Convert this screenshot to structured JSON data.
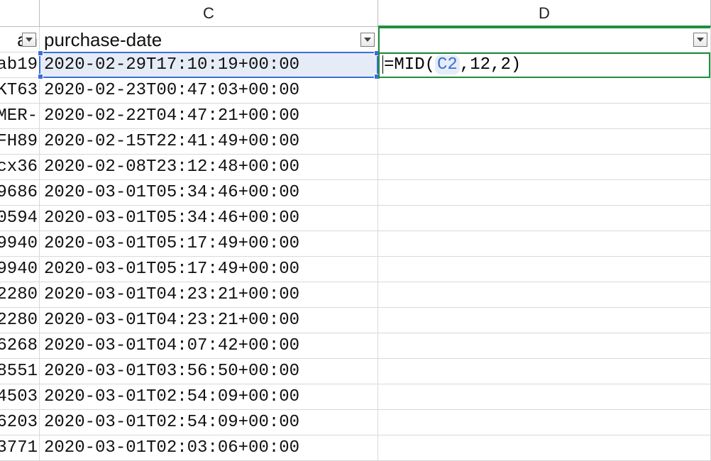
{
  "columns": {
    "b_letter": "",
    "c_letter": "C",
    "d_letter": "D"
  },
  "header_row": {
    "b": "an",
    "c": "purchase-date",
    "d": ""
  },
  "formula": {
    "prefix": "=MID(",
    "ref": "C2",
    "sep1": ",",
    "arg2": "12",
    "sep2": ",",
    "arg3": "2",
    "suffix": ")"
  },
  "rows": [
    {
      "b": "ab19",
      "c": "2020-02-29T17:10:19+00:00",
      "d": ""
    },
    {
      "b": "KT63",
      "c": "2020-02-23T00:47:03+00:00",
      "d": ""
    },
    {
      "b": "MER-",
      "c": "2020-02-22T04:47:21+00:00",
      "d": ""
    },
    {
      "b": "FH89",
      "c": "2020-02-15T22:41:49+00:00",
      "d": ""
    },
    {
      "b": "cx36",
      "c": "2020-02-08T23:12:48+00:00",
      "d": ""
    },
    {
      "b": "9686",
      "c": "2020-03-01T05:34:46+00:00",
      "d": ""
    },
    {
      "b": "0594",
      "c": "2020-03-01T05:34:46+00:00",
      "d": ""
    },
    {
      "b": "9940",
      "c": "2020-03-01T05:17:49+00:00",
      "d": ""
    },
    {
      "b": "9940",
      "c": "2020-03-01T05:17:49+00:00",
      "d": ""
    },
    {
      "b": "2280",
      "c": "2020-03-01T04:23:21+00:00",
      "d": ""
    },
    {
      "b": "2280",
      "c": "2020-03-01T04:23:21+00:00",
      "d": ""
    },
    {
      "b": "6268",
      "c": "2020-03-01T04:07:42+00:00",
      "d": ""
    },
    {
      "b": "8551",
      "c": "2020-03-01T03:56:50+00:00",
      "d": ""
    },
    {
      "b": "4503",
      "c": "2020-03-01T02:54:09+00:00",
      "d": ""
    },
    {
      "b": "6203",
      "c": "2020-03-01T02:54:09+00:00",
      "d": ""
    },
    {
      "b": "3771",
      "c": "2020-03-01T02:03:06+00:00",
      "d": ""
    }
  ]
}
